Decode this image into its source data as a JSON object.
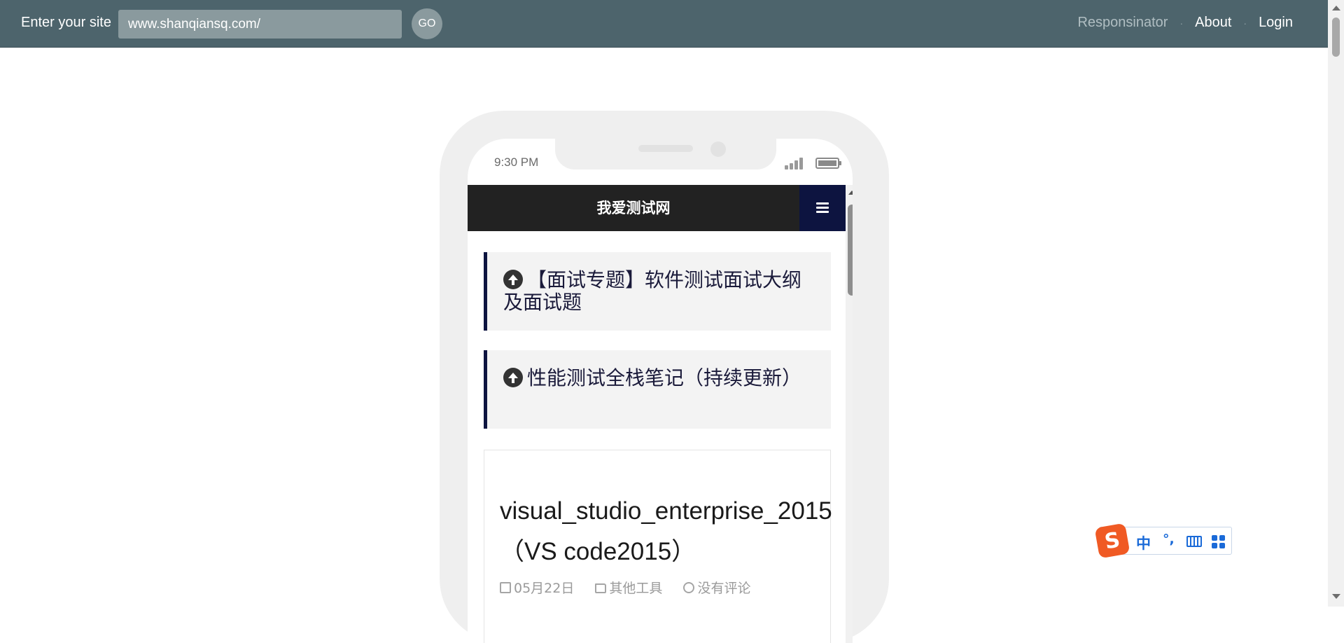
{
  "toolbar": {
    "site_label": "Enter your site",
    "site_value": "www.shanqiansq.com/",
    "go_label": "GO",
    "nav": {
      "responsinator": "Responsinator",
      "separator": "·",
      "about": "About",
      "login": "Login"
    }
  },
  "phone": {
    "status_time": "9:30 PM",
    "site": {
      "title": "我爱测试网",
      "menu_icon": "hamburger-icon"
    },
    "sticky_posts": [
      {
        "icon": "arrow-circle-up-icon",
        "title": "【面试专题】软件测试面试大纲及面试题"
      },
      {
        "icon": "arrow-circle-up-icon",
        "title": "性能测试全栈笔记（持续更新）"
      }
    ],
    "post": {
      "title_line1": "visual_studio_enterprise_2015",
      "title_line2": "（VS code2015）",
      "date": "05月22日",
      "category": "其他工具",
      "comments": "没有评论"
    }
  },
  "ime": {
    "logo": "S",
    "mode": "中",
    "punctuation": "°,",
    "keyboard_icon": "keyboard-icon",
    "toolbox_icon": "grid-icon"
  },
  "colors": {
    "toolbar_bg": "#4d646c",
    "site_header_bg": "#222222",
    "menu_btn_bg": "#0d1440",
    "card_accent": "#0d1440",
    "ime_accent": "#1a6ad8",
    "ime_logo": "#f05a24"
  }
}
